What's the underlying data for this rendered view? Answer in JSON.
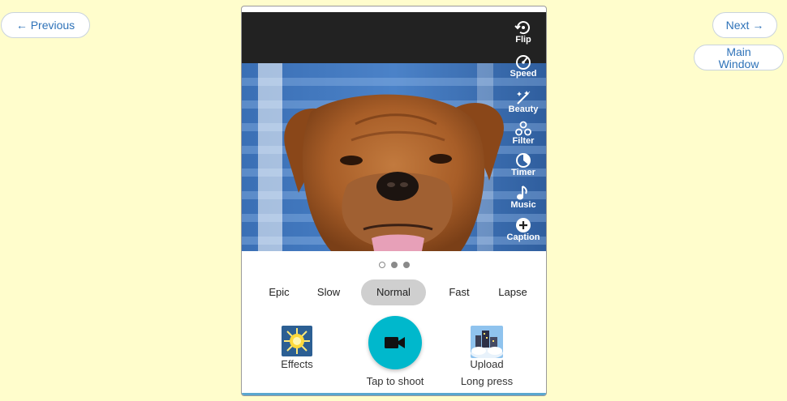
{
  "nav": {
    "previous_label": "← Previous",
    "next_label": "Next →",
    "main_window_line1": "Main",
    "main_window_line2": "Window"
  },
  "tools": [
    {
      "label": "Flip",
      "icon": "flip-icon"
    },
    {
      "label": "Speed",
      "icon": "speed-icon"
    },
    {
      "label": "Beauty",
      "icon": "beauty-icon"
    },
    {
      "label": "Filter",
      "icon": "filter-icon"
    },
    {
      "label": "Timer",
      "icon": "timer-icon"
    },
    {
      "label": "Music",
      "icon": "music-icon"
    },
    {
      "label": "Caption",
      "icon": "caption-icon"
    }
  ],
  "pager": {
    "count": 3,
    "active_index": 0
  },
  "speed_options": [
    "Epic",
    "Slow",
    "Normal",
    "Fast",
    "Lapse"
  ],
  "speed_selected": "Normal",
  "actions": {
    "effects_label": "Effects",
    "shoot_label": "Tap to shoot",
    "upload_label": "Upload",
    "long_press_label": "Long press"
  },
  "colors": {
    "page_background": "#fffdcc",
    "accent": "#00b8cc",
    "link": "#2e72b8"
  }
}
